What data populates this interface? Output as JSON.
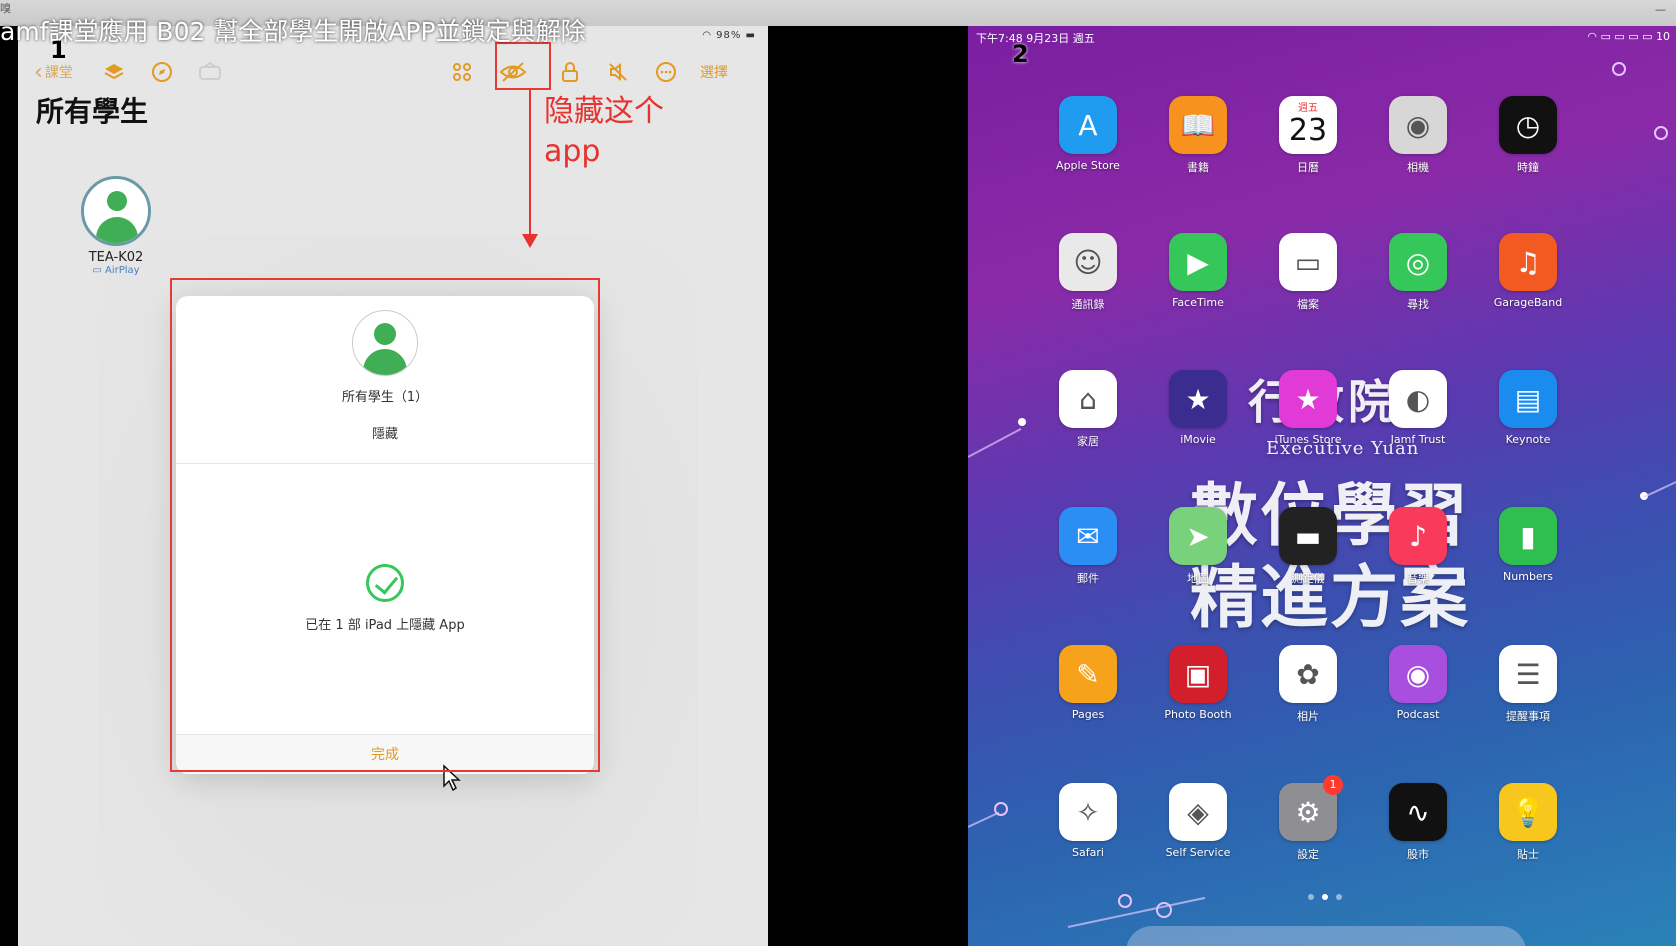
{
  "video": {
    "title": "amf課堂應用 B02 幫全部學生開啟APP並鎖定與解除",
    "corner_char": "嗅"
  },
  "screens": {
    "left_number": "1",
    "right_number": "2"
  },
  "left_ipad": {
    "status": "98%",
    "toolbar": {
      "back_label": "課堂",
      "select_label": "選擇"
    },
    "heading": "所有學生",
    "student": {
      "name": "TEA-K02",
      "sub": "AirPlay"
    },
    "annotation": "隐藏这个 app",
    "sheet": {
      "title": "所有學生（1）",
      "action": "隱藏",
      "message": "已在 1 部 iPad 上隱藏 App",
      "done": "完成"
    }
  },
  "right_ipad": {
    "status_left": "下午7:48  9月23日 週五",
    "status_right": "10",
    "calendar": {
      "weekday": "週五",
      "day": "23"
    },
    "watermark": {
      "org": "行政院",
      "org_en": "Executive Yuan",
      "line1": "數位學習",
      "line2": "精進方案"
    },
    "apps": [
      {
        "label": "Apple Store",
        "icon": "app-store-icon",
        "color": "#1f9bf0"
      },
      {
        "label": "書籍",
        "icon": "books-icon",
        "color": "#f7921e"
      },
      {
        "label": "日曆",
        "icon": "calendar-icon",
        "color": "#ffffff"
      },
      {
        "label": "相機",
        "icon": "camera-icon",
        "color": "#d7d7d7"
      },
      {
        "label": "時鐘",
        "icon": "clock-icon",
        "color": "#111111"
      },
      {
        "label": "通訊錄",
        "icon": "contacts-icon",
        "color": "#e9e9e9"
      },
      {
        "label": "FaceTime",
        "icon": "facetime-icon",
        "color": "#35c759"
      },
      {
        "label": "檔案",
        "icon": "files-icon",
        "color": "#ffffff"
      },
      {
        "label": "尋找",
        "icon": "find-my-icon",
        "color": "#35c759"
      },
      {
        "label": "GarageBand",
        "icon": "garageband-icon",
        "color": "#f25a22"
      },
      {
        "label": "家居",
        "icon": "home-icon",
        "color": "#ffffff"
      },
      {
        "label": "iMovie",
        "icon": "imovie-icon",
        "color": "#3a2d8f"
      },
      {
        "label": "iTunes Store",
        "icon": "itunes-store-icon",
        "color": "#e13ad6"
      },
      {
        "label": "Jamf Trust",
        "icon": "jamf-trust-icon",
        "color": "#ffffff"
      },
      {
        "label": "Keynote",
        "icon": "keynote-icon",
        "color": "#1a8cf0"
      },
      {
        "label": "郵件",
        "icon": "mail-icon",
        "color": "#2a8ef5"
      },
      {
        "label": "地圖",
        "icon": "maps-icon",
        "color": "#7ad17c"
      },
      {
        "label": "測距儀",
        "icon": "measure-icon",
        "color": "#222222"
      },
      {
        "label": "音樂",
        "icon": "music-icon",
        "color": "#f93a5a"
      },
      {
        "label": "Numbers",
        "icon": "numbers-icon",
        "color": "#2fbf4f"
      },
      {
        "label": "Pages",
        "icon": "pages-icon",
        "color": "#f7a21b"
      },
      {
        "label": "Photo Booth",
        "icon": "photo-booth-icon",
        "color": "#d21f2b"
      },
      {
        "label": "相片",
        "icon": "photos-icon",
        "color": "#ffffff"
      },
      {
        "label": "Podcast",
        "icon": "podcast-icon",
        "color": "#a94fe0"
      },
      {
        "label": "提醒事項",
        "icon": "reminders-icon",
        "color": "#ffffff"
      },
      {
        "label": "Safari",
        "icon": "safari-icon",
        "color": "#ffffff"
      },
      {
        "label": "Self Service",
        "icon": "self-service-icon",
        "color": "#ffffff"
      },
      {
        "label": "設定",
        "icon": "settings-icon",
        "color": "#8e8e93",
        "badge": "1"
      },
      {
        "label": "股市",
        "icon": "stocks-icon",
        "color": "#111111"
      },
      {
        "label": "貼士",
        "icon": "tips-icon",
        "color": "#f7c71e"
      }
    ]
  }
}
